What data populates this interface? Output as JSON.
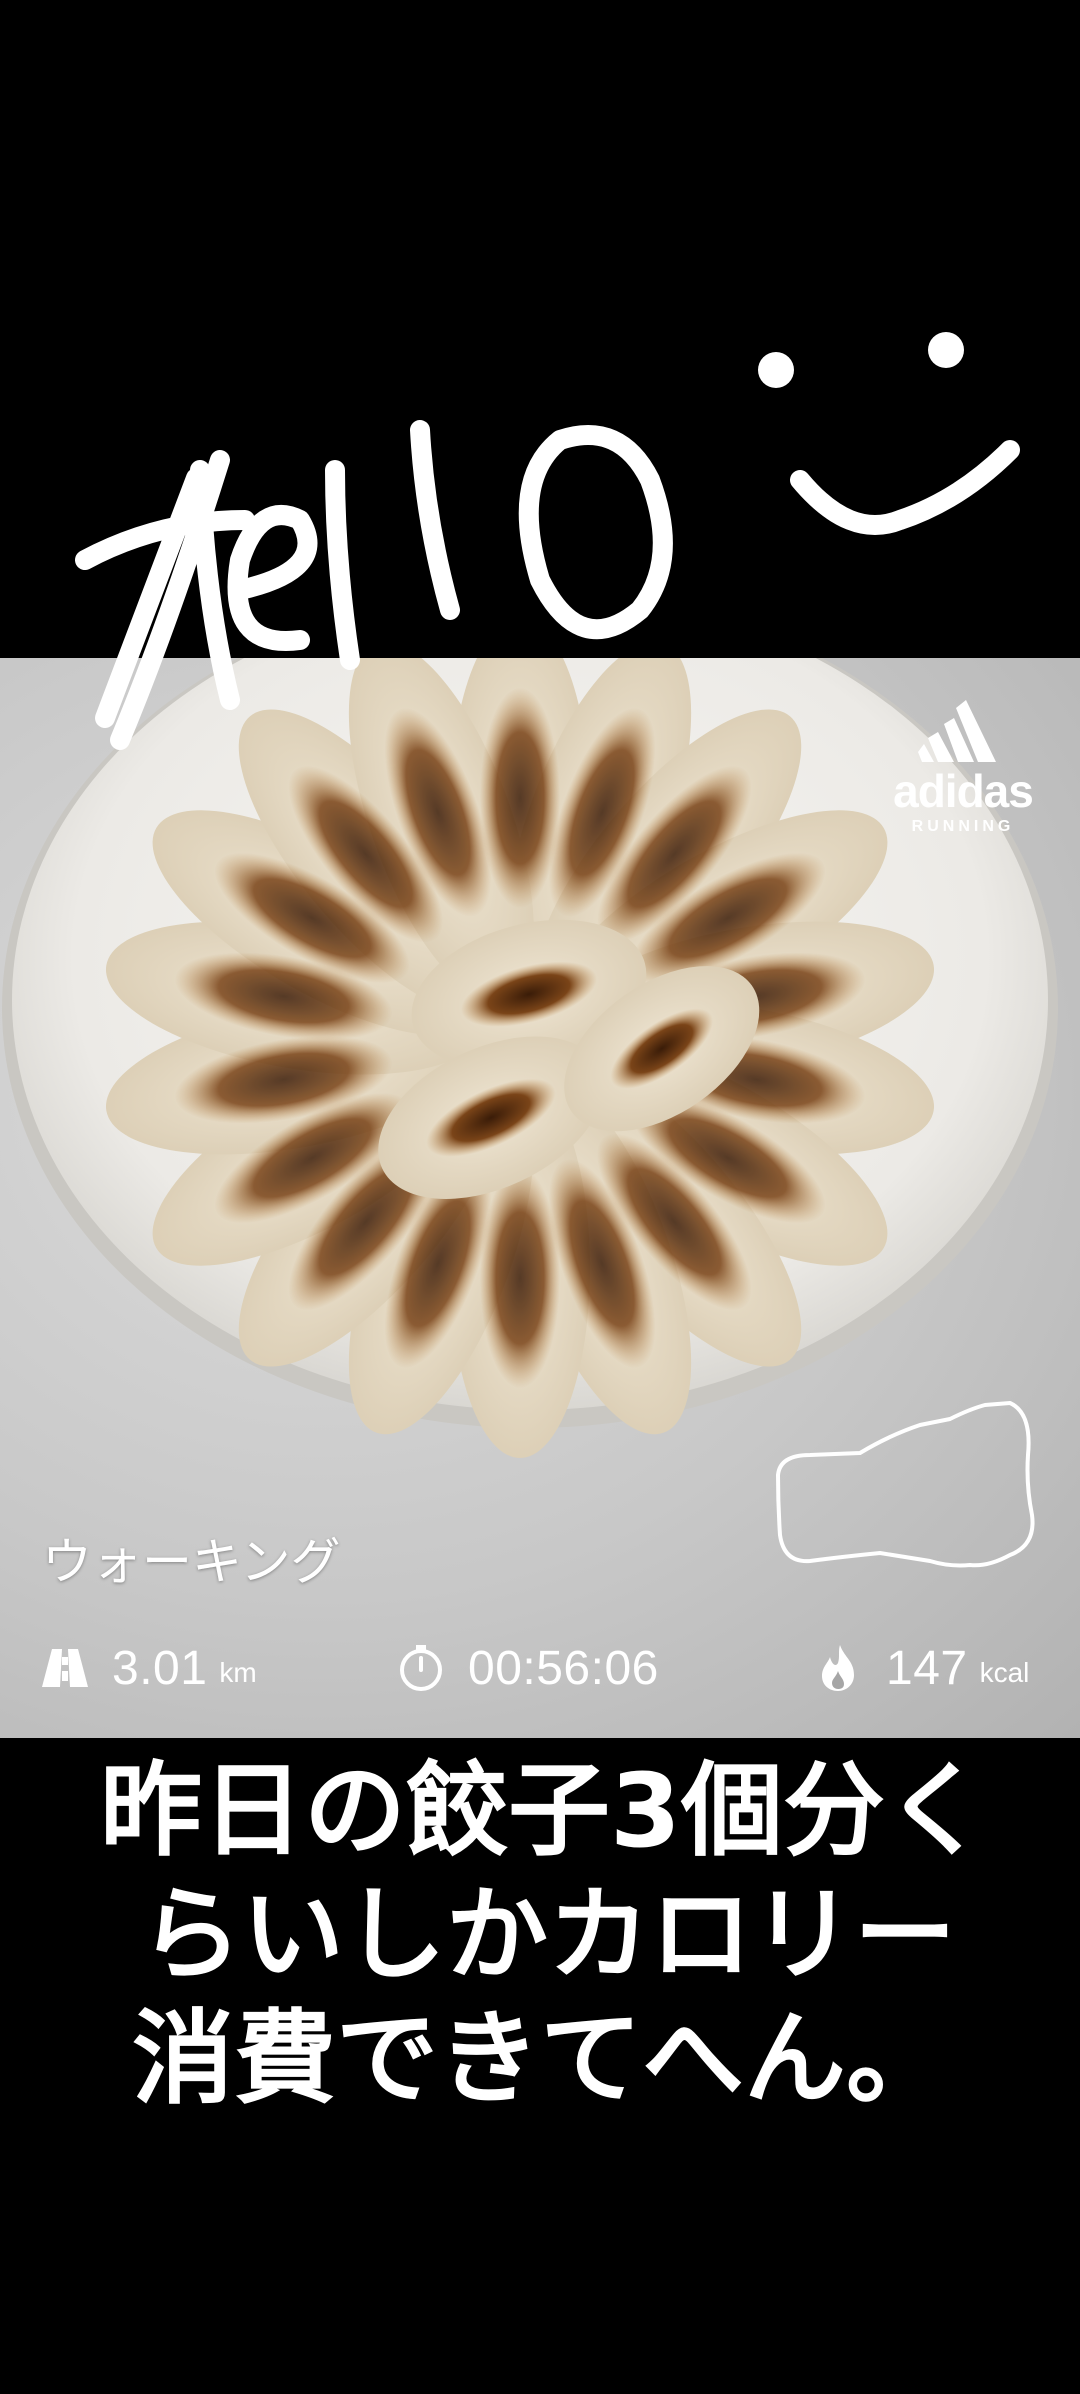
{
  "overlay": {
    "handwriting_text": "Hello",
    "smiley": "smiley-face"
  },
  "brand": {
    "name": "adidas",
    "subtitle": "RUNNING"
  },
  "activity": {
    "type": "ウォーキング"
  },
  "stats": {
    "distance": {
      "value": "3.01",
      "unit": "km",
      "icon": "road-icon"
    },
    "duration": {
      "value": "00:56:06",
      "icon": "stopwatch-icon"
    },
    "calories": {
      "value": "147",
      "unit": "kcal",
      "icon": "flame-icon"
    }
  },
  "caption": {
    "line1": "昨日の餃子3個分く",
    "line2": "らいしかカロリー",
    "line3": "消費できてへん。"
  },
  "colors": {
    "background": "#000000",
    "text": "#ffffff",
    "plate": "#f2f1ee",
    "gyoza": "#e6dcc8",
    "char": "#6a3a1a"
  }
}
